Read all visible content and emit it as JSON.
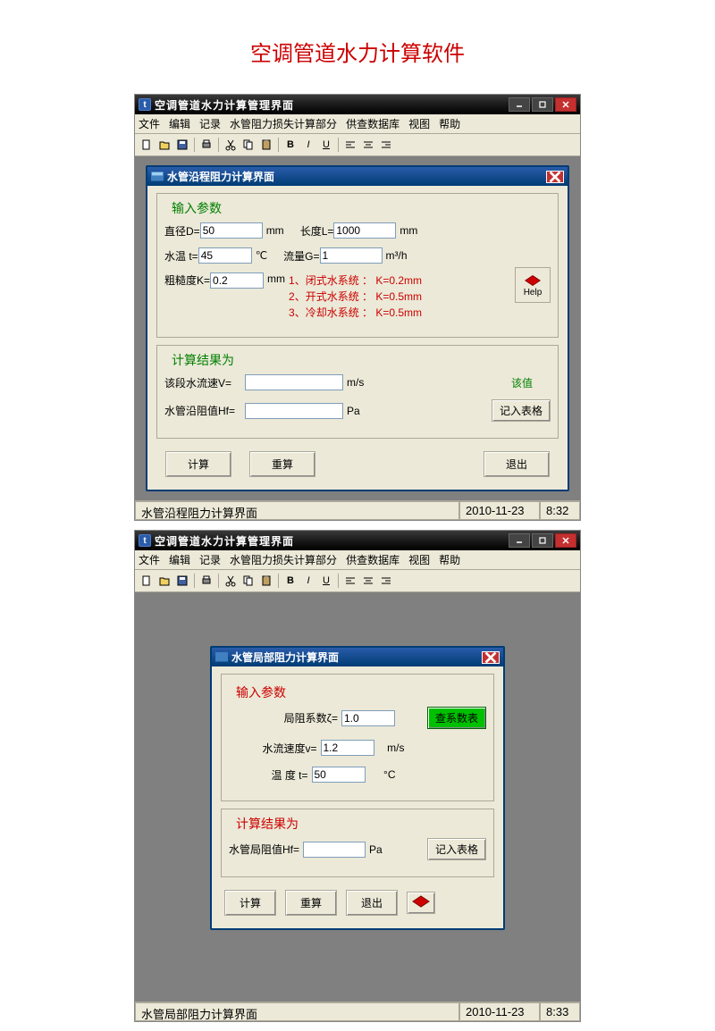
{
  "page_title": "空调管道水力计算软件",
  "app1": {
    "title": "空调管道水力计算管理界面",
    "menu": [
      "文件",
      "编辑",
      "记录",
      "水管阻力损失计算部分",
      "供查数据库",
      "视图",
      "帮助"
    ],
    "dialog": {
      "title": "水管沿程阻力计算界面",
      "group_input": "输入参数",
      "diameter_lbl": "直径D=",
      "diameter_val": "50",
      "mm": "mm",
      "length_lbl": "长度L=",
      "length_val": "1000",
      "temp_lbl": "水温 t=",
      "temp_val": "45",
      "celsius": "℃",
      "flow_lbl": "流量G=",
      "flow_val": "1",
      "flow_unit": "m³/h",
      "rough_lbl": "粗糙度K=",
      "rough_val": "0.2",
      "hint1": "1、闭式水系统 ： K=0.2mm",
      "hint2": "2、开式水系统 ： K=0.5mm",
      "hint3": "3、冷却水系统 ： K=0.5mm",
      "help": "Help",
      "group_result": "计算结果为",
      "velocity_lbl": "该段水流速V=",
      "velocity_unit": "m/s",
      "gaizhi": "该值",
      "hf_lbl": "水管沿阻值Hf=",
      "pa": "Pa",
      "record_btn": "记入表格",
      "calc": "计算",
      "recalc": "重算",
      "exit": "退出"
    },
    "status": {
      "text": "水管沿程阻力计算界面",
      "date": "2010-11-23",
      "time": "8:32"
    }
  },
  "app2": {
    "title": "空调管道水力计算管理界面",
    "menu": [
      "文件",
      "编辑",
      "记录",
      "水管阻力损失计算部分",
      "供查数据库",
      "视图",
      "帮助"
    ],
    "dialog": {
      "title": "水管局部阻力计算界面",
      "group_input": "输入参数",
      "zeta_lbl": "局阻系数ζ=",
      "zeta_val": "1.0",
      "lookup_btn": "查系数表",
      "velocity_lbl": "水流速度v=",
      "velocity_val": "1.2",
      "velocity_unit": "m/s",
      "temp_lbl": "温 度 t=",
      "temp_val": "50",
      "celsius": "°C",
      "group_result": "计算结果为",
      "hf_lbl": "水管局阻值Hf=",
      "pa": "Pa",
      "record_btn": "记入表格",
      "calc": "计算",
      "recalc": "重算",
      "exit": "退出"
    },
    "status": {
      "text": "水管局部阻力计算界面",
      "date": "2010-11-23",
      "time": "8:33"
    }
  }
}
